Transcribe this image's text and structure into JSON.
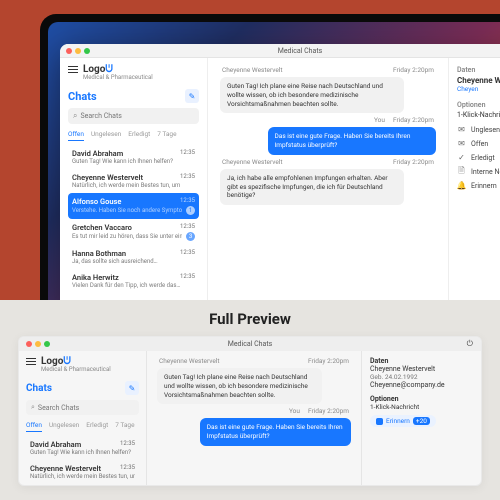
{
  "window_title": "Medical Chats",
  "brand": {
    "name": "Logo",
    "subtitle": "Medical & Pharmaceutical"
  },
  "chats": {
    "heading": "Chats",
    "search_placeholder": "Search Chats",
    "tabs": [
      "Offen",
      "Ungelesen",
      "Erledigt",
      "7 Tage"
    ],
    "active_tab": 0,
    "items": [
      {
        "name": "David Abraham",
        "time": "12:35",
        "preview": "Guten Tag! Wie kann ich Ihnen helfen?",
        "unread": 0
      },
      {
        "name": "Cheyenne Westervelt",
        "time": "12:35",
        "preview": "Natürlich, ich werde mein Bestes tun, um Ihnen…",
        "unread": 0
      },
      {
        "name": "Alfonso Gouse",
        "time": "12:35",
        "preview": "Verstehe. Haben Sie noch andere Symptome?",
        "unread": 1,
        "active": true
      },
      {
        "name": "Gretchen Vaccaro",
        "time": "12:35",
        "preview": "Es tut mir leid zu hören, dass Sie unter einer Migräne le…",
        "unread": 3
      },
      {
        "name": "Hanna Bothman",
        "time": "12:35",
        "preview": "Ja, das sollte sich ausreichend…",
        "unread": 0
      },
      {
        "name": "Anika Herwitz",
        "time": "12:35",
        "preview": "Vielen Dank für den Tipp, ich werde das…",
        "unread": 0
      }
    ]
  },
  "conversation": {
    "messages": [
      {
        "from": "Cheyenne Westervelt",
        "time": "Friday 2:20pm",
        "dir": "in",
        "text": "Guten Tag! Ich plane eine Reise nach Deutschland und wollte wissen, ob ich besondere medizinische Vorsichtsmaßnahmen beachten sollte."
      },
      {
        "from": "You",
        "time": "Friday 2:20pm",
        "dir": "out",
        "text": "Das ist eine gute Frage. Haben Sie bereits Ihren Impfstatus überprüft?"
      },
      {
        "from": "Cheyenne Westervelt",
        "time": "Friday 2:20pm",
        "dir": "in",
        "text": "Ja, ich habe alle empfohlenen Impfungen erhalten. Aber gibt es spezifische Impfungen, die ich für Deutschland benötige?"
      }
    ]
  },
  "info": {
    "section_data_label": "Daten",
    "patient_name": "Cheyenne Westervelt",
    "dob": "Geb. 24.02.1992",
    "email": "Cheyenne@company.de",
    "options_label": "Optionen",
    "quick_label": "1-Klick-Nachricht",
    "options": [
      {
        "icon": "✉",
        "label": "Unglesen"
      },
      {
        "icon": "✉",
        "label": "Offen"
      },
      {
        "icon": "✓",
        "label": "Erledigt"
      },
      {
        "icon": "🗎",
        "label": "Interne Notiz"
      },
      {
        "icon": "🔔",
        "label": "Erinnern"
      }
    ]
  },
  "lower_heading": "Full Preview",
  "preview_badge": "+20"
}
